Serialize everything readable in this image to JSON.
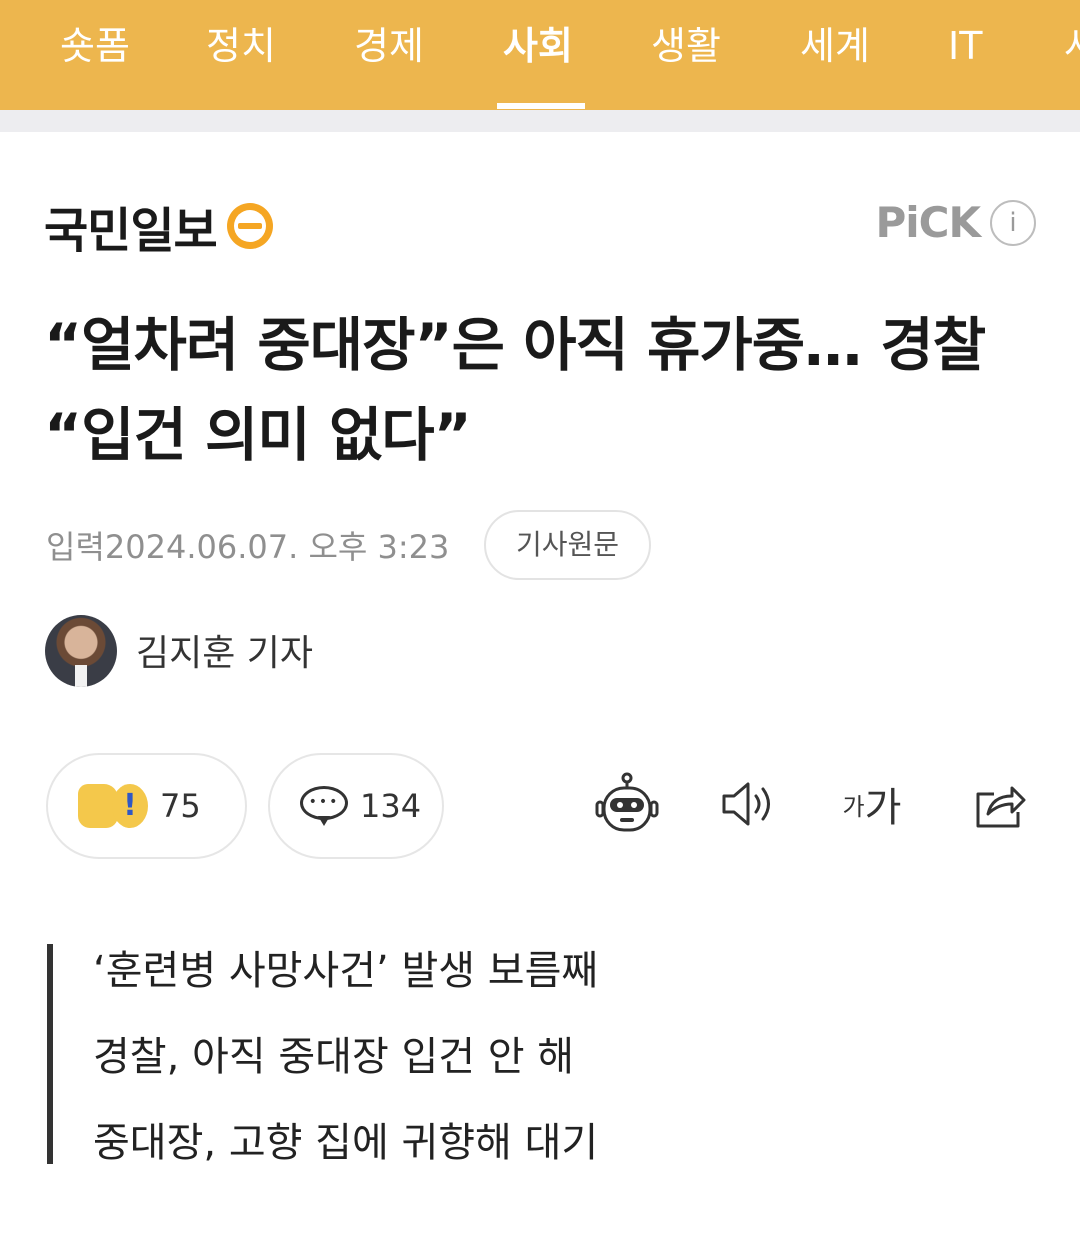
{
  "nav": {
    "tabs": [
      {
        "label": "숏폼",
        "active": false
      },
      {
        "label": "정치",
        "active": false
      },
      {
        "label": "경제",
        "active": false
      },
      {
        "label": "사회",
        "active": true
      },
      {
        "label": "생활",
        "active": false
      },
      {
        "label": "세계",
        "active": false
      },
      {
        "label": "IT",
        "active": false
      },
      {
        "label": "사",
        "active": false
      }
    ],
    "bar_color": "#EDB64E"
  },
  "press": {
    "name": "국민일보",
    "pick_label": "PiCK",
    "info_icon": "info-icon"
  },
  "article": {
    "headline": "“얼차려 중대장”은 아직 휴가중… 경찰 “입건 의미 없다”",
    "date_text": "입력2024.06.07. 오후 3:23",
    "original_button": "기사원문",
    "reporter": "김지훈 기자"
  },
  "actions": {
    "reaction_count": "75",
    "comment_count": "134",
    "font_small": "가",
    "font_big": "가",
    "icons": [
      "thumbs-up-icon",
      "surprise-icon",
      "comment-bubble-icon",
      "robot-summary-icon",
      "speaker-icon",
      "font-size-icon",
      "share-icon"
    ]
  },
  "summary": {
    "lines": [
      "‘훈련병 사망사건’ 발생 보름째",
      "경찰, 아직 중대장 입건 안 해",
      "중대장, 고향 집에 귀향해 대기"
    ]
  }
}
